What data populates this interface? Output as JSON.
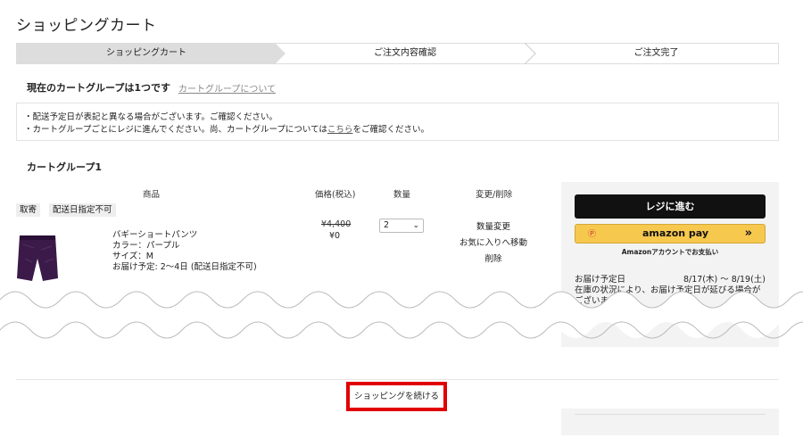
{
  "header": {
    "title": "ショッピングカート"
  },
  "steps": [
    {
      "label": "ショッピングカート",
      "active": true
    },
    {
      "label": "ご注文内容確認",
      "active": false
    },
    {
      "label": "ご注文完了",
      "active": false
    }
  ],
  "cart_group_summary": {
    "count_text": "現在のカートグループは1つです",
    "about_link": "カートグループについて"
  },
  "notice": {
    "line1": "・配送予定日が表記と異なる場合がございます。ご確認ください。",
    "line2_prefix": "・カートグループごとにレジに進んでください。尚、カートグループについては",
    "line2_link": "こちら",
    "line2_suffix": "をご確認ください。"
  },
  "group": {
    "heading": "カートグループ1",
    "columns": {
      "product": "商品",
      "price": "価格(税込)",
      "qty": "数量",
      "change": "変更/削除"
    },
    "tags": [
      "取寄",
      "配送日指定不可"
    ],
    "item": {
      "name": "バギーショートパンツ",
      "color": "カラー：パープル",
      "size": "サイズ：M",
      "delivery": "お届け予定: 2〜4日 (配送日指定不可)",
      "price_original": "¥4,400",
      "price_current": "¥0",
      "quantity": "2",
      "actions": [
        "数量変更",
        "お気に入りへ移動",
        "削除"
      ]
    }
  },
  "sidebar": {
    "checkout_label": "レジに進む",
    "amazon_pay_label": "amazon pay",
    "amazon_pay_icon": "amazon-coin-icon",
    "amazon_note": "Amazonアカウントでお支払い",
    "delivery_label": "お届け予定日",
    "delivery_range": "8/17(木) 〜 8/19(土)",
    "delivery_note": "在庫の状況により、お届け予定日が延びる場合がございます"
  },
  "footer": {
    "continue_label": "ショッピングを続ける"
  },
  "colors": {
    "highlight": "#e10000",
    "amazon_yellow": "#f6c84e",
    "checkout_black": "#111111",
    "product_purple": "#3b1a4a"
  }
}
